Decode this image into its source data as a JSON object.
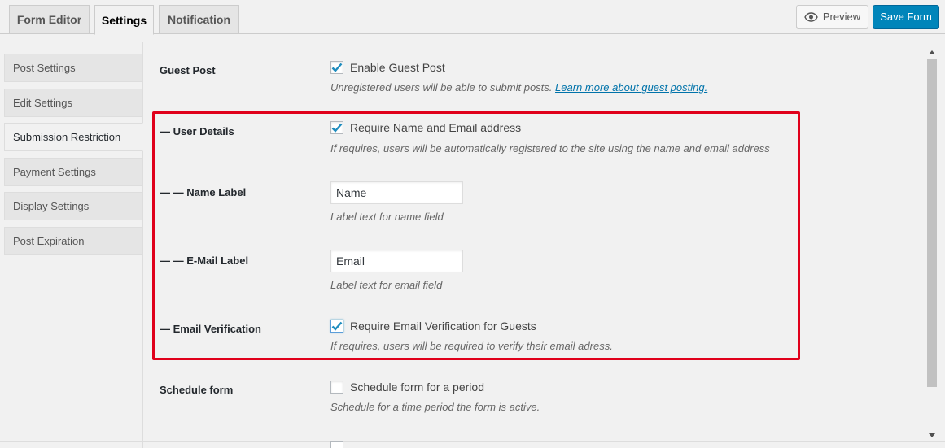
{
  "tabs": [
    {
      "label": "Form Editor",
      "active": false
    },
    {
      "label": "Settings",
      "active": true
    },
    {
      "label": "Notification",
      "active": false
    }
  ],
  "toolbar": {
    "preview_label": "Preview",
    "save_label": "Save Form"
  },
  "sidebar": {
    "items": [
      {
        "label": "Post Settings",
        "active": false
      },
      {
        "label": "Edit Settings",
        "active": false
      },
      {
        "label": "Submission Restriction",
        "active": true
      },
      {
        "label": "Payment Settings",
        "active": false
      },
      {
        "label": "Display Settings",
        "active": false
      },
      {
        "label": "Post Expiration",
        "active": false
      }
    ]
  },
  "settings": {
    "guest_post": {
      "label": "Guest Post",
      "checkbox_label": "Enable Guest Post",
      "checked": true,
      "desc": "Unregistered users will be able to submit posts.",
      "link": "Learn more about guest posting."
    },
    "user_details": {
      "label": "— User Details",
      "checkbox_label": "Require Name and Email address",
      "checked": true,
      "desc": "If requires, users will be automatically registered to the site using the name and email address"
    },
    "name_label": {
      "label": "— — Name Label",
      "value": "Name",
      "desc": "Label text for name field"
    },
    "email_label": {
      "label": "— — E-Mail Label",
      "value": "Email",
      "desc": "Label text for email field"
    },
    "email_verification": {
      "label": "— Email Verification",
      "checkbox_label": "Require Email Verification for Guests",
      "checked": true,
      "desc": "If requires, users will be required to verify their email adress."
    },
    "schedule_form": {
      "label": "Schedule form",
      "checkbox_label": "Schedule form for a period",
      "checked": false,
      "desc": "Schedule for a time period the form is active."
    }
  },
  "colors": {
    "accent": "#0085ba",
    "highlight": "#e0001b",
    "check": "#1e8cbe"
  }
}
